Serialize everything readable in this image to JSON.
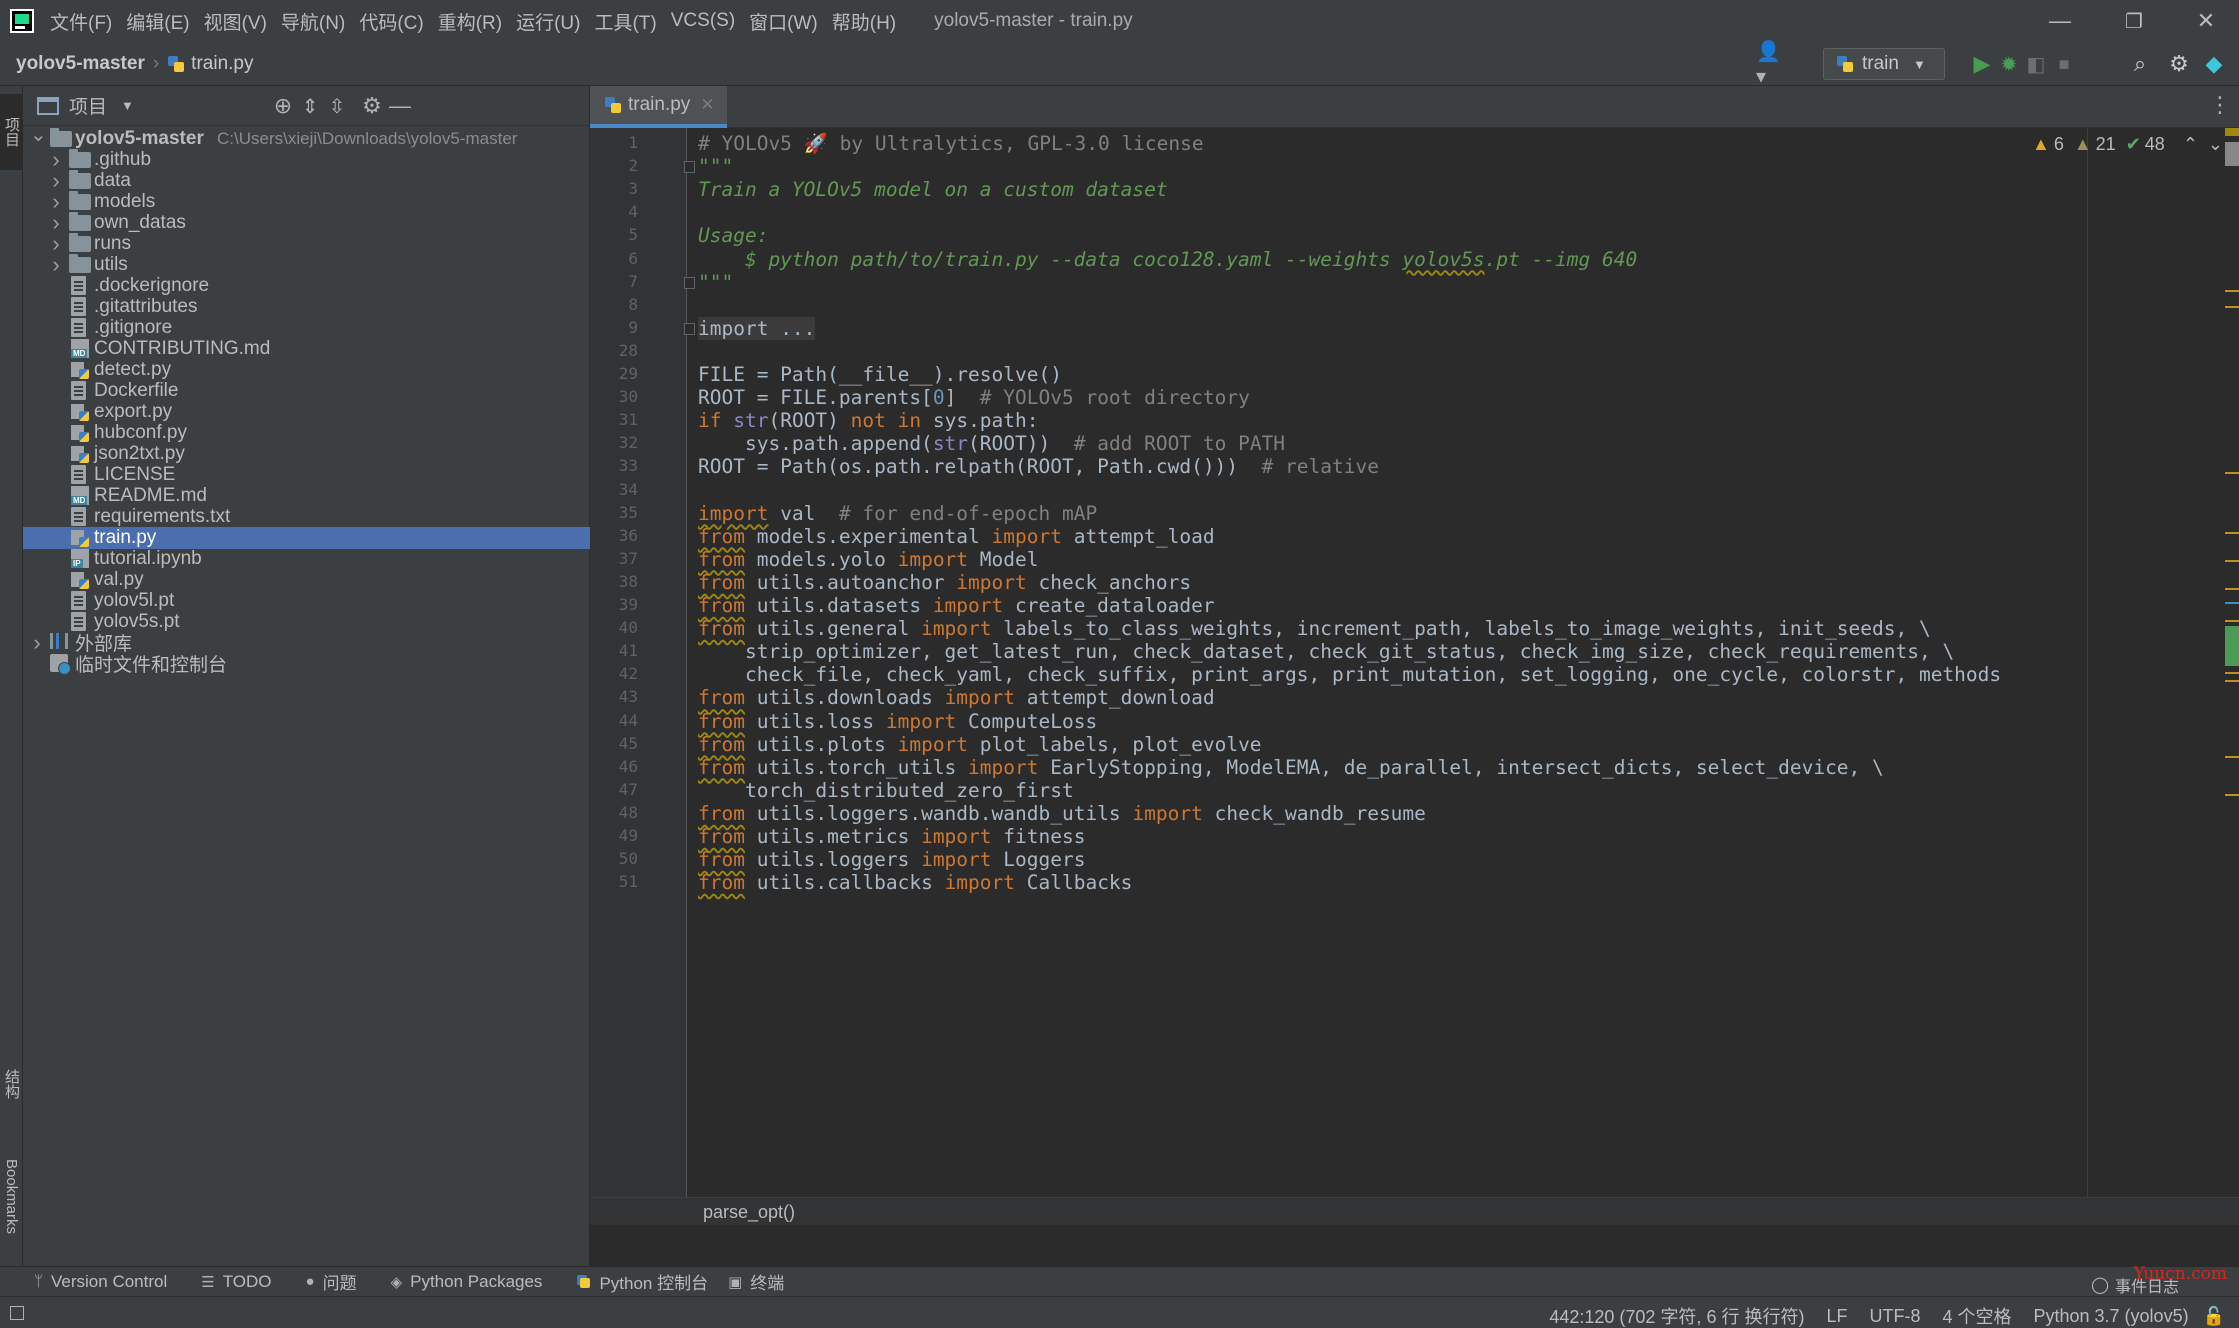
{
  "window": {
    "title": "yolov5-master - train.py",
    "menu": [
      "文件(F)",
      "编辑(E)",
      "视图(V)",
      "导航(N)",
      "代码(C)",
      "重构(R)",
      "运行(U)",
      "工具(T)",
      "VCS(S)",
      "窗口(W)",
      "帮助(H)"
    ],
    "controls": {
      "minimize": "—",
      "restore": "❐",
      "close": "✕"
    }
  },
  "navbar": {
    "project": "yolov5-master",
    "file": "train.py",
    "run_config": "train"
  },
  "left_stripe": {
    "project_tab": "项目",
    "structure_tab": "结构",
    "bookmarks_tab": "Bookmarks"
  },
  "project_panel": {
    "title": "项目",
    "tree": [
      {
        "label": "yolov5-master",
        "path": "C:\\Users\\xieji\\Downloads\\yolov5-master",
        "type": "root"
      },
      {
        "label": ".github",
        "type": "folder"
      },
      {
        "label": "data",
        "type": "folder"
      },
      {
        "label": "models",
        "type": "folder"
      },
      {
        "label": "own_datas",
        "type": "folder"
      },
      {
        "label": "runs",
        "type": "folder"
      },
      {
        "label": "utils",
        "type": "folder"
      },
      {
        "label": ".dockerignore",
        "type": "file"
      },
      {
        "label": ".gitattributes",
        "type": "file"
      },
      {
        "label": ".gitignore",
        "type": "file"
      },
      {
        "label": "CONTRIBUTING.md",
        "type": "md"
      },
      {
        "label": "detect.py",
        "type": "py"
      },
      {
        "label": "Dockerfile",
        "type": "file"
      },
      {
        "label": "export.py",
        "type": "py"
      },
      {
        "label": "hubconf.py",
        "type": "py"
      },
      {
        "label": "json2txt.py",
        "type": "py"
      },
      {
        "label": "LICENSE",
        "type": "file"
      },
      {
        "label": "README.md",
        "type": "md"
      },
      {
        "label": "requirements.txt",
        "type": "file"
      },
      {
        "label": "train.py",
        "type": "py",
        "selected": true
      },
      {
        "label": "tutorial.ipynb",
        "type": "ipynb"
      },
      {
        "label": "val.py",
        "type": "py"
      },
      {
        "label": "yolov5l.pt",
        "type": "file"
      },
      {
        "label": "yolov5s.pt",
        "type": "file"
      },
      {
        "label": "外部库",
        "type": "lib"
      },
      {
        "label": "临时文件和控制台",
        "type": "scratch"
      }
    ]
  },
  "editor": {
    "tab_label": "train.py",
    "inspections": {
      "warnings": "6",
      "weak_warnings": "21",
      "ok": "48"
    },
    "breadcrumb": "parse_opt()",
    "lines": [
      {
        "n": "1",
        "html": "<span class='c-comment'># YOLOv5 🚀 by Ultralytics, GPL-3.0 license</span>"
      },
      {
        "n": "2",
        "html": "<span class='c-doc'>\"\"\"</span>",
        "fold": true
      },
      {
        "n": "3",
        "html": "<span class='c-doc'>Train a YOLOv5 model on a custom dataset</span>"
      },
      {
        "n": "4",
        "html": ""
      },
      {
        "n": "5",
        "html": "<span class='c-doc'>Usage:</span>"
      },
      {
        "n": "6",
        "html": "<span class='c-doc'>    $ python path/to/train.py --data coco128.yaml --weights <span class='c-warn'>yolov5s</span>.pt --img 640</span>"
      },
      {
        "n": "7",
        "html": "<span class='c-doc'>\"\"\"</span>",
        "fold": true
      },
      {
        "n": "8",
        "html": ""
      },
      {
        "n": "9",
        "html": "<span class='c-fold'><span class='c-kw' style='color:#a9b7c6'>import</span> ...</span>",
        "fold": true
      },
      {
        "n": "28",
        "html": ""
      },
      {
        "n": "29",
        "html": "FILE = Path(__file__).resolve()"
      },
      {
        "n": "30",
        "html": "ROOT = FILE.parents[<span class='c-num'>0</span>]  <span class='c-comment'># YOLOv5 root directory</span>"
      },
      {
        "n": "31",
        "html": "<span class='c-kw'>if</span> <span class='c-builtin'>str</span>(ROOT) <span class='c-kw'>not in</span> sys.path:"
      },
      {
        "n": "32",
        "html": "    sys.path.append(<span class='c-builtin'>str</span>(ROOT))  <span class='c-comment'># add ROOT to PATH</span>"
      },
      {
        "n": "33",
        "html": "ROOT = Path(os.path.relpath(ROOT, Path.cwd()))  <span class='c-comment'># relative</span>"
      },
      {
        "n": "34",
        "html": ""
      },
      {
        "n": "35",
        "html": "<span class='c-kw c-warn'>import</span> val  <span class='c-comment'># for end-of-epoch mAP</span>"
      },
      {
        "n": "36",
        "html": "<span class='c-kw c-warn'>from</span> models.experimental <span class='c-kw'>import</span> attempt_load"
      },
      {
        "n": "37",
        "html": "<span class='c-kw c-warn'>from</span> models.yolo <span class='c-kw'>import</span> Model"
      },
      {
        "n": "38",
        "html": "<span class='c-kw c-warn'>from</span> utils.autoanchor <span class='c-kw'>import</span> check_anchors"
      },
      {
        "n": "39",
        "html": "<span class='c-kw c-warn'>from</span> utils.datasets <span class='c-kw'>import</span> create_dataloader"
      },
      {
        "n": "40",
        "html": "<span class='c-kw c-warn'>from</span> utils.general <span class='c-kw'>import</span> labels_to_class_weights, increment_path, labels_to_image_weights, init_seeds, \\"
      },
      {
        "n": "41",
        "html": "    strip_optimizer, get_latest_run, check_dataset, check_git_status, check_img_size, check_requirements, \\"
      },
      {
        "n": "42",
        "html": "    check_file, check_yaml, check_suffix, print_args, print_mutation, set_logging, one_cycle, colorstr, methods"
      },
      {
        "n": "43",
        "html": "<span class='c-kw c-warn'>from</span> utils.downloads <span class='c-kw'>import</span> attempt_download"
      },
      {
        "n": "44",
        "html": "<span class='c-kw c-warn'>from</span> utils.loss <span class='c-kw'>import</span> ComputeLoss"
      },
      {
        "n": "45",
        "html": "<span class='c-kw c-warn'>from</span> utils.plots <span class='c-kw'>import</span> plot_labels, plot_evolve"
      },
      {
        "n": "46",
        "html": "<span class='c-kw c-warn'>from</span> utils.torch_utils <span class='c-kw'>import</span> EarlyStopping, ModelEMA, de_parallel, intersect_dicts, select_device, \\"
      },
      {
        "n": "47",
        "html": "    torch_distributed_zero_first"
      },
      {
        "n": "48",
        "html": "<span class='c-kw c-warn'>from</span> utils.loggers.wandb.wandb_utils <span class='c-kw'>import</span> check_wandb_resume"
      },
      {
        "n": "49",
        "html": "<span class='c-kw c-warn'>from</span> utils.metrics <span class='c-kw'>import</span> fitness"
      },
      {
        "n": "50",
        "html": "<span class='c-kw c-warn'>from</span> utils.loggers <span class='c-kw'>import</span> Loggers"
      },
      {
        "n": "51",
        "html": "<span class='c-kw c-warn'>from</span> utils.callbacks <span class='c-kw'>import</span> Callbacks"
      }
    ]
  },
  "tool_windows": [
    "Version Control",
    "TODO",
    "问题",
    "Python Packages",
    "Python 控制台",
    "终端"
  ],
  "event_log": "事件日志",
  "watermark": "Yuucn.com",
  "status": {
    "caret": "442:120 (702 字符, 6 行 换行符)",
    "line_sep": "LF",
    "encoding": "UTF-8",
    "indent": "4 个空格",
    "interpreter": "Python 3.7 (yolov5)"
  },
  "colors": {
    "selection": "#4b6eaf",
    "keyword": "#cc7832",
    "docstring": "#629755",
    "comment": "#808080",
    "number": "#6897bb",
    "accent_tab": "#4a88c7",
    "run_green": "#499c54"
  }
}
